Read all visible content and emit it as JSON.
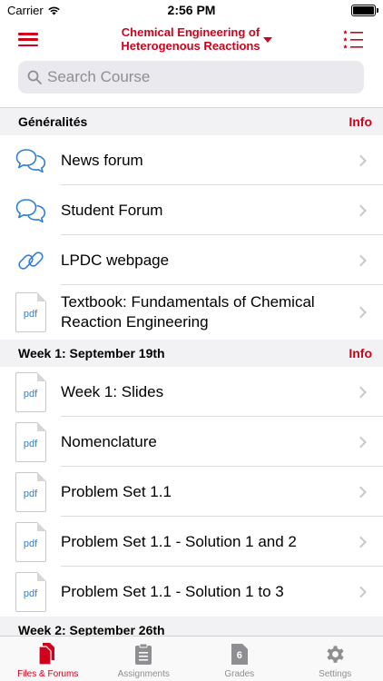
{
  "status": {
    "carrier": "Carrier",
    "time": "2:56 PM"
  },
  "nav": {
    "title": "Chemical Engineering of Heterogenous Reactions"
  },
  "search": {
    "placeholder": "Search Course"
  },
  "sections": [
    {
      "title": "Généralités",
      "info": "Info",
      "items": [
        {
          "label": "News forum",
          "icon": "forum-icon"
        },
        {
          "label": "Student Forum",
          "icon": "forum-icon"
        },
        {
          "label": "LPDC webpage",
          "icon": "link-icon"
        },
        {
          "label": "Textbook: Fundamentals of Chemical Reaction Engineering",
          "icon": "pdf-icon"
        }
      ]
    },
    {
      "title": "Week 1: September 19th",
      "info": "Info",
      "items": [
        {
          "label": "Week 1: Slides",
          "icon": "pdf-icon"
        },
        {
          "label": "Nomenclature",
          "icon": "pdf-icon"
        },
        {
          "label": "Problem Set 1.1",
          "icon": "pdf-icon"
        },
        {
          "label": "Problem Set 1.1 - Solution 1 and 2",
          "icon": "pdf-icon"
        },
        {
          "label": "Problem Set 1.1 - Solution 1 to 3",
          "icon": "pdf-icon"
        }
      ]
    },
    {
      "title": "Week 2: September 26th",
      "info": ""
    }
  ],
  "pdf_label": "pdf",
  "tabs": [
    {
      "label": "Files & Forums",
      "icon": "files-icon",
      "active": true
    },
    {
      "label": "Assignments",
      "icon": "clipboard-icon",
      "active": false
    },
    {
      "label": "Grades",
      "icon": "grades-icon",
      "badge": "6",
      "active": false
    },
    {
      "label": "Settings",
      "icon": "gear-icon",
      "active": false
    }
  ],
  "colors": {
    "accent": "#d0021b",
    "link_blue": "#2f7fd8",
    "inactive": "#8e8e93"
  }
}
